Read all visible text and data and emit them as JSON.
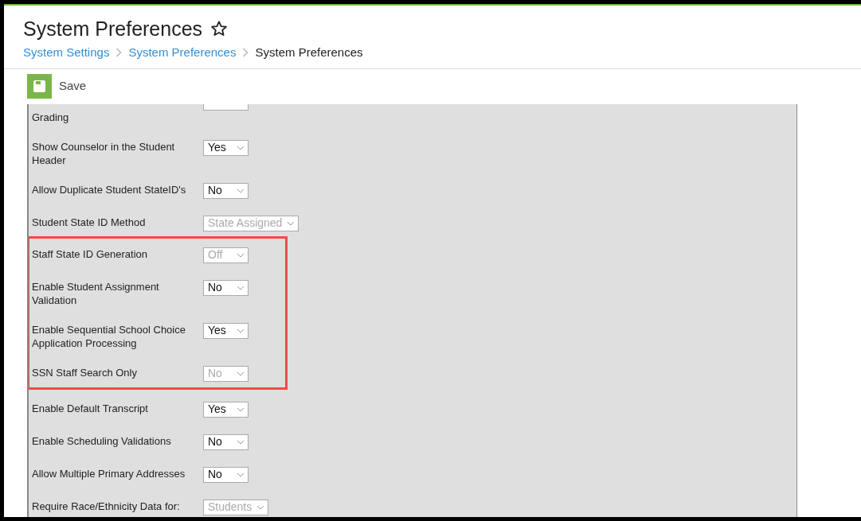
{
  "header": {
    "title": "System Preferences",
    "favorite": false,
    "breadcrumbs": [
      {
        "label": "System Settings",
        "link": true
      },
      {
        "label": "System Preferences",
        "link": true
      },
      {
        "label": "System Preferences",
        "link": false
      }
    ]
  },
  "toolbar": {
    "save_label": "Save"
  },
  "preferences": [
    {
      "kind": "cut",
      "label": "Grading",
      "highlighted": false
    },
    {
      "label": "Show Counselor in the Student Header",
      "value": "Yes",
      "disabled": false,
      "highlighted": false
    },
    {
      "label": "Allow Duplicate Student StateID's",
      "value": "No",
      "disabled": false,
      "highlighted": false
    },
    {
      "label": "Student State ID Method",
      "value": "State Assigned",
      "disabled": true,
      "highlighted": false
    },
    {
      "label": "Staff State ID Generation",
      "value": "Off",
      "disabled": true,
      "highlighted": true
    },
    {
      "label": "Enable Student Assignment Validation",
      "value": "No",
      "disabled": false,
      "highlighted": true
    },
    {
      "label": "Enable Sequential School Choice Application Processing",
      "value": "Yes",
      "disabled": false,
      "highlighted": true
    },
    {
      "label": "SSN Staff Search Only",
      "value": "No",
      "disabled": true,
      "highlighted": true
    },
    {
      "label": "Enable Default Transcript",
      "value": "Yes",
      "disabled": false,
      "highlighted": false
    },
    {
      "label": "Enable Scheduling Validations",
      "value": "No",
      "disabled": false,
      "highlighted": false
    },
    {
      "label": "Allow Multiple Primary Addresses",
      "value": "No",
      "disabled": false,
      "highlighted": false
    },
    {
      "label": "Require Race/Ethnicity Data for:",
      "value": "Students",
      "disabled": true,
      "highlighted": false
    }
  ]
}
